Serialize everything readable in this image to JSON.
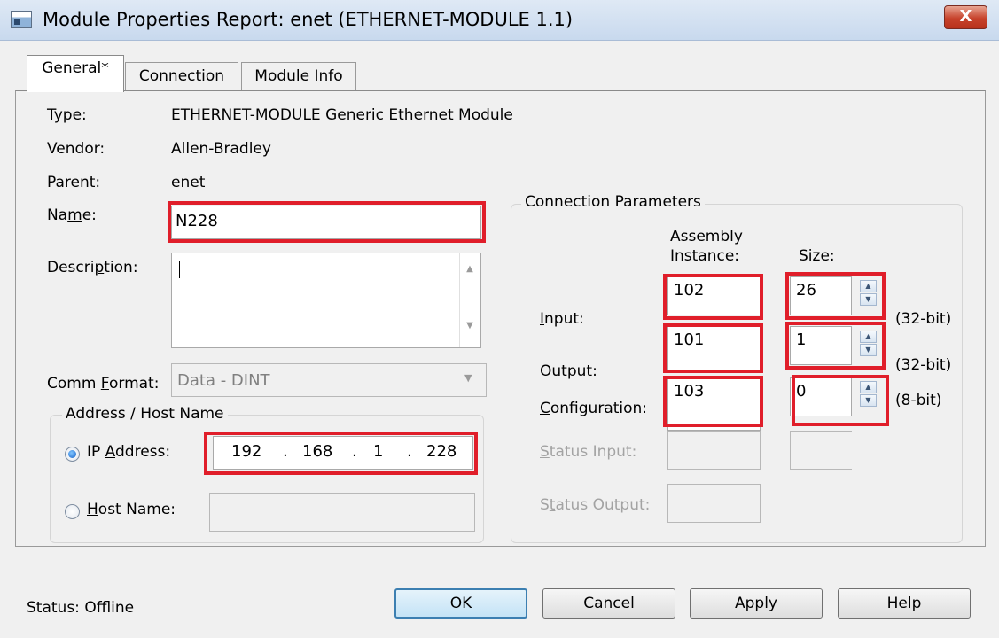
{
  "window": {
    "title": "Module Properties Report: enet (ETHERNET-MODULE 1.1)",
    "close_glyph": "X"
  },
  "tabs": [
    {
      "label": "General*",
      "active": true
    },
    {
      "label": "Connection",
      "active": false
    },
    {
      "label": "Module Info",
      "active": false
    }
  ],
  "general": {
    "type_label": "Type:",
    "type_value": "ETHERNET-MODULE Generic Ethernet Module",
    "vendor_label": "Vendor:",
    "vendor_value": "Allen-Bradley",
    "parent_label": "Parent:",
    "parent_value": "enet",
    "name_label_pre": "Na",
    "name_label_u": "m",
    "name_label_post": "e:",
    "name_value": "N228",
    "description_label_pre": "Descri",
    "description_label_u": "p",
    "description_label_post": "tion:",
    "description_value": "",
    "comm_format_label_pre": "Comm ",
    "comm_format_label_u": "F",
    "comm_format_label_post": "ormat:",
    "comm_format_value": "Data - DINT"
  },
  "address": {
    "group_title": "Address / Host Name",
    "ip_label_pre": "IP ",
    "ip_label_u": "A",
    "ip_label_post": "ddress:",
    "ip_octets": [
      "192",
      "168",
      "1",
      "228"
    ],
    "ip_dot": ".",
    "host_label_u": "H",
    "host_label_post": "ost Name:",
    "host_value": "",
    "selected": "ip"
  },
  "connection": {
    "group_title": "Connection Parameters",
    "col_assembly_line1": "Assembly",
    "col_assembly_line2": "Instance:",
    "col_size": "Size:",
    "rows": [
      {
        "label_u": "I",
        "label_post": "nput:",
        "instance": "102",
        "size": "26",
        "unit": "(32-bit)"
      },
      {
        "label_pre": "O",
        "label_u": "u",
        "label_post": "tput:",
        "instance": "101",
        "size": "1",
        "unit": "(32-bit)"
      },
      {
        "label_u": "C",
        "label_post": "onfiguration:",
        "instance": "103",
        "size": "0",
        "unit": "(8-bit)"
      }
    ],
    "status_input_label_u": "S",
    "status_input_label_post": "tatus Input:",
    "status_output_label_pre": "S",
    "status_output_label_u": "t",
    "status_output_label_post": "atus Output:"
  },
  "footer": {
    "status_label": "Status:",
    "status_value": "Offline",
    "ok": "OK",
    "cancel": "Cancel",
    "apply": "Apply",
    "help": "Help"
  },
  "highlight_color": "#e01e2a"
}
